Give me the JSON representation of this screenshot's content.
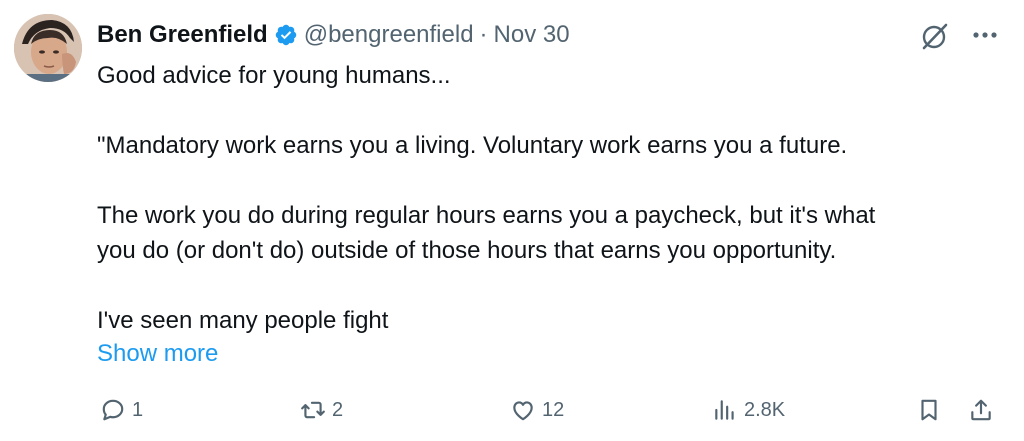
{
  "tweet": {
    "author_name": "Ben Greenfield",
    "handle": "@bengreenfield",
    "separator": "·",
    "date": "Nov 30",
    "lines": [
      "Good advice for young humans...",
      "\"Mandatory work earns you a living. Voluntary work earns you a future.",
      "The work you do during regular hours earns you a paycheck, but it's what",
      "you do (or don't do) outside of those hours that earns you opportunity.",
      "I've seen many people fight"
    ],
    "show_more": "Show more"
  },
  "metrics": {
    "replies": "1",
    "reposts": "2",
    "likes": "12",
    "views": "2.8K"
  },
  "colors": {
    "text": "#0f1419",
    "secondary": "#536471",
    "link": "#1d9bf0",
    "verified": "#1d9bf0"
  },
  "icons": [
    "verified-badge-icon",
    "grok-icon",
    "more-icon",
    "reply-icon",
    "repost-icon",
    "like-icon",
    "views-icon",
    "bookmark-icon",
    "share-icon"
  ]
}
